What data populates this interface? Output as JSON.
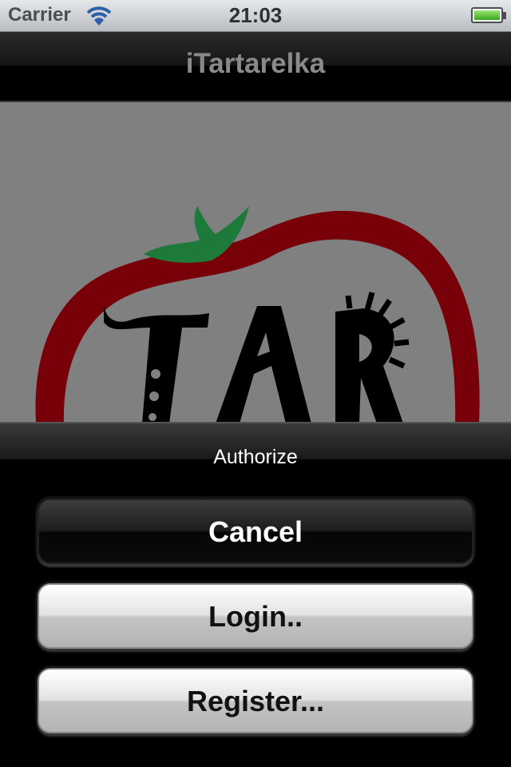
{
  "status_bar": {
    "carrier": "Carrier",
    "time": "21:03",
    "wifi_icon": "wifi-icon",
    "battery_icon": "battery-icon"
  },
  "nav": {
    "title": "iTartarelka"
  },
  "logo": {
    "text": "TAR",
    "icon": "tomato-logo",
    "colors": {
      "tomato": "#780009",
      "leaf": "#1e7a3a",
      "letters": "#000000",
      "background": "#808080"
    }
  },
  "action_sheet": {
    "title": "Authorize",
    "buttons": {
      "cancel": "Cancel",
      "login": "Login..",
      "register": "Register..."
    }
  }
}
